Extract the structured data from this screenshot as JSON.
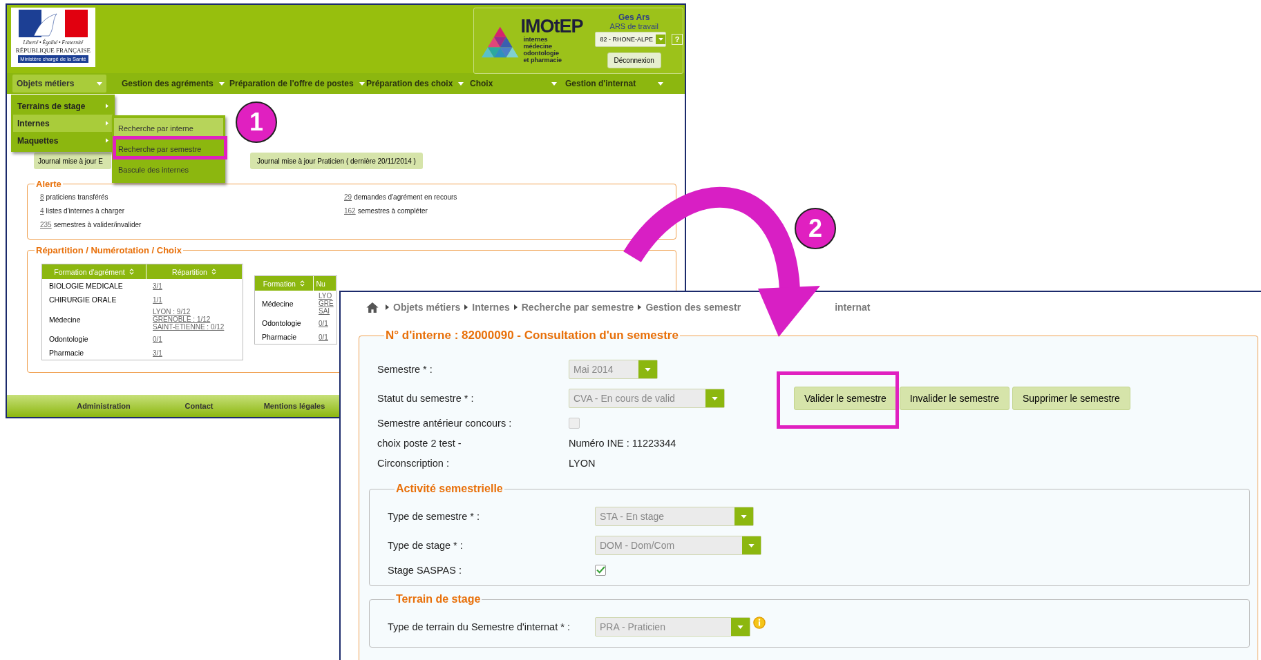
{
  "back_window": {
    "logo": {
      "motto": "Liberté • Égalité • Fraternité",
      "country": "RÉPUBLIQUE FRANÇAISE",
      "ministry": "Ministère chargé de la Santé"
    },
    "brand": {
      "name": "IMOtEP",
      "tagline": [
        "internes",
        "médecine",
        "odontologie",
        "et pharmacie"
      ]
    },
    "user": {
      "name": "Ges Ars",
      "role": "ARS de travail",
      "region": "82 - RHONE-ALPE",
      "help": "?",
      "logout": "Déconnexion"
    },
    "nav": [
      {
        "label": "Objets métiers",
        "selected": true
      },
      {
        "label": "Gestion des agréments",
        "selected": false
      },
      {
        "label": "Préparation de l'offre de postes",
        "selected": false
      },
      {
        "label": "Préparation des choix",
        "selected": false
      },
      {
        "label": "Choix",
        "selected": false
      },
      {
        "label": "Gestion d'internat",
        "selected": false
      }
    ],
    "menu": [
      {
        "label": "Terrains de stage",
        "selected": false
      },
      {
        "label": "Internes",
        "selected": true
      },
      {
        "label": "Maquettes",
        "selected": false
      }
    ],
    "submenu": [
      {
        "label": "Recherche par interne",
        "selected": true
      },
      {
        "label": "Recherche par semestre",
        "selected": false
      },
      {
        "label": "Bascule des internes",
        "selected": false
      }
    ],
    "journal_buttons": [
      "Journal mise à jour E",
      "Journal mise à jour Praticien ( dernière 20/11/2014 )"
    ],
    "alerts": {
      "title": "Alerte",
      "columns": [
        [
          {
            "count": "8",
            "text": "praticiens transférés"
          },
          {
            "count": "4",
            "text": "listes d'internes à charger"
          },
          {
            "count": "235",
            "text": "semestres à valider/invalider"
          }
        ],
        [
          {
            "count": "29",
            "text": "demandes d'agrément en recours"
          },
          {
            "count": "162",
            "text": "semestres à compléter"
          }
        ]
      ]
    },
    "repartition": {
      "title": "Répartition / Numérotation / Choix",
      "table_1": {
        "columns": [
          "Formation d'agrément",
          "Répartition"
        ],
        "rows": [
          {
            "name": "BIOLOGIE MEDICALE",
            "links": [
              "3/1"
            ]
          },
          {
            "name": "CHIRURGIE ORALE",
            "links": [
              "1/1"
            ]
          },
          {
            "name": "Médecine",
            "links": [
              "LYON : 9/12",
              "GRENOBLE : 1/12",
              "SAINT-ETIENNE : 0/12"
            ]
          },
          {
            "name": "Odontologie",
            "links": [
              "0/1"
            ]
          },
          {
            "name": "Pharmacie",
            "links": [
              "3/1"
            ]
          }
        ]
      },
      "table_2": {
        "columns": [
          "Formation",
          "Nu"
        ],
        "rows": [
          {
            "name": "Médecine",
            "links": [
              "LYO",
              "GRE",
              "SAI"
            ]
          },
          {
            "name": "Odontologie",
            "links": [
              "0/1"
            ]
          },
          {
            "name": "Pharmacie",
            "links": [
              "0/1"
            ]
          }
        ]
      }
    },
    "footer": [
      "Administration",
      "Contact",
      "Mentions légales"
    ]
  },
  "front_window": {
    "breadcrumb": {
      "items": [
        "Objets métiers",
        "Internes",
        "Recherche par semestre",
        "Gestion des semestr"
      ],
      "after_arrow": "internat"
    },
    "form": {
      "title": "N° d'interne : 82000090 - Consultation d'un semestre",
      "fields": [
        {
          "kind": "select",
          "label": "Semestre * :",
          "value": "Mai 2014"
        },
        {
          "kind": "select",
          "label": "Statut du semestre * :",
          "value": "CVA - En cours de valid",
          "actions": [
            "Valider le semestre",
            "Invalider le semestre",
            "Supprimer le semestre"
          ]
        },
        {
          "kind": "checkbox",
          "label": "Semestre antérieur concours :",
          "checked": false
        },
        {
          "kind": "text",
          "label": "choix poste 2 test -",
          "value": "Numéro INE : 11223344"
        },
        {
          "kind": "text",
          "label": "Circonscription :",
          "value": "LYON"
        }
      ]
    },
    "sections": [
      {
        "title": "Activité semestrielle",
        "fields": [
          {
            "kind": "select",
            "label": "Type de semestre * :",
            "value": "STA - En stage"
          },
          {
            "kind": "select",
            "label": "Type de stage * :",
            "value": "DOM - Dom/Com"
          },
          {
            "kind": "checkbox",
            "label": "Stage SASPAS :",
            "checked": true
          }
        ]
      },
      {
        "title": "Terrain de stage",
        "fields": [
          {
            "kind": "select",
            "label": "Type de terrain du Semestre d'internat * :",
            "value": "PRA - Praticien",
            "info": true
          }
        ]
      }
    ]
  },
  "annotations": {
    "steps": [
      "1",
      "2"
    ]
  }
}
